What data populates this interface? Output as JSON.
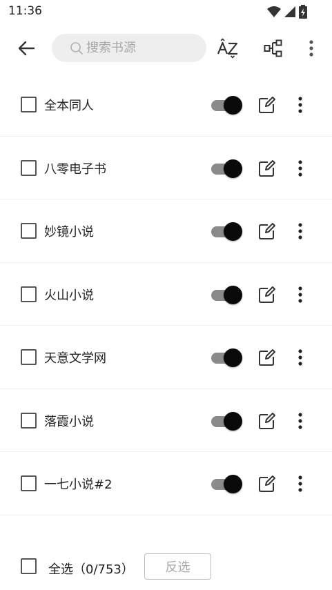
{
  "status_bar": {
    "time": "11:36",
    "icons": [
      "wifi-icon",
      "signal-icon",
      "battery-icon"
    ]
  },
  "toolbar": {
    "back_icon": "arrow-left-icon",
    "search_placeholder": "搜索书源",
    "search_value": "",
    "sort_icon": "sort-az-icon",
    "group_icon": "group-icon",
    "more_icon": "more-vertical-icon"
  },
  "sources": [
    {
      "name": "全本同人",
      "enabled": true,
      "checked": false
    },
    {
      "name": "八零电子书",
      "enabled": true,
      "checked": false
    },
    {
      "name": "妙镜小说",
      "enabled": true,
      "checked": false
    },
    {
      "name": "火山小说",
      "enabled": true,
      "checked": false
    },
    {
      "name": "天意文学网",
      "enabled": true,
      "checked": false
    },
    {
      "name": "落霞小说",
      "enabled": true,
      "checked": false
    },
    {
      "name": "一七小说#2",
      "enabled": true,
      "checked": false
    },
    {
      "name": "",
      "enabled": true,
      "checked": false
    }
  ],
  "bottom_bar": {
    "select_all_label": "全选（0/753）",
    "invert_label": "反选"
  },
  "colors": {
    "switch_track": "#8a8a8a",
    "switch_thumb": "#0a0a0a",
    "search_bg": "#eeeeee",
    "placeholder": "#a8a8a8"
  }
}
